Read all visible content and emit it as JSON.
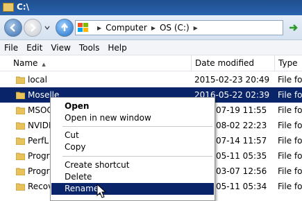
{
  "window": {
    "title": "C:\\"
  },
  "address": {
    "crumbs": [
      "Computer",
      "OS (C:)"
    ]
  },
  "menu": [
    "File",
    "Edit",
    "View",
    "Tools",
    "Help"
  ],
  "columns": {
    "name": "Name",
    "date": "Date modified",
    "type": "Type"
  },
  "rows": [
    {
      "name": "local",
      "date": "2015-02-23 20:49",
      "type": "File fold"
    },
    {
      "name": "Moselle",
      "date": "2016-05-22 02:39",
      "type": "File fold",
      "selected": true
    },
    {
      "name": "MSOC",
      "date": "07-19 11:55",
      "type": "File fold"
    },
    {
      "name": "NVIDI",
      "date": "08-02 22:23",
      "type": "File fold"
    },
    {
      "name": "PerfL",
      "date": "07-14 11:57",
      "type": "File fold"
    },
    {
      "name": "Progra",
      "date": "05-11 05:35",
      "type": "File fold"
    },
    {
      "name": "Progra",
      "date": "03-07 12:56",
      "type": "File fold"
    },
    {
      "name": "Recov",
      "date": "05-11 05:34",
      "type": "File fold"
    }
  ],
  "context_menu": {
    "items": [
      "Open",
      "Open in new window",
      "Cut",
      "Copy",
      "Create shortcut",
      "Delete",
      "Rename"
    ],
    "highlighted": "Rename"
  },
  "colors": {
    "selection": "#0a246a",
    "titlebar": "#1f4f8f"
  }
}
